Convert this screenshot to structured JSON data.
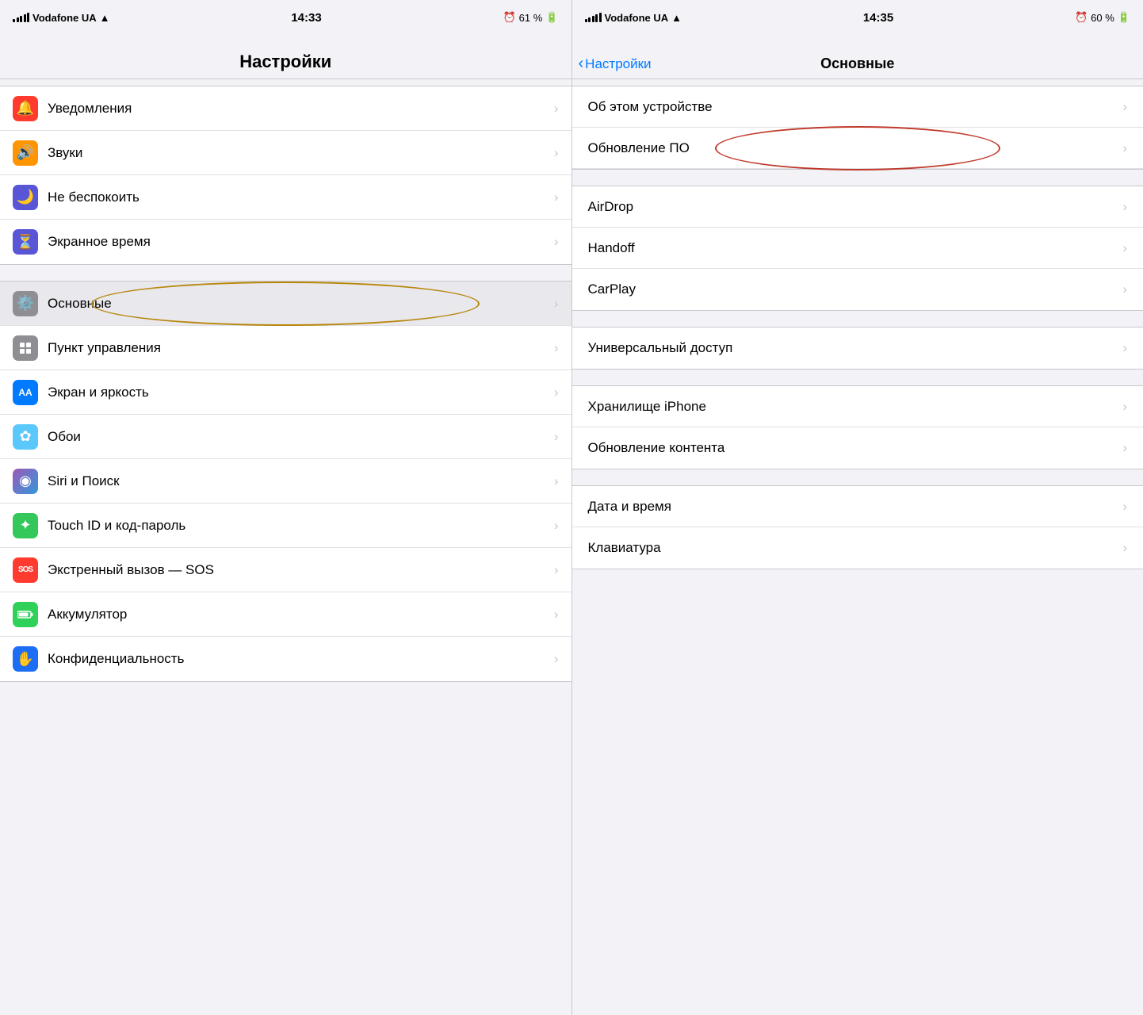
{
  "left_panel": {
    "status": {
      "carrier": "Vodafone UA",
      "time": "14:33",
      "battery": "61 %"
    },
    "title": "Настройки",
    "rows": [
      {
        "id": "notifications",
        "label": "Уведомления",
        "icon": "🔔",
        "icon_class": "icon-red"
      },
      {
        "id": "sounds",
        "label": "Звуки",
        "icon": "🔊",
        "icon_class": "icon-orange-light"
      },
      {
        "id": "do-not-disturb",
        "label": "Не беспокоить",
        "icon": "🌙",
        "icon_class": "icon-purple"
      },
      {
        "id": "screen-time",
        "label": "Экранное время",
        "icon": "⏳",
        "icon_class": "icon-blue"
      }
    ],
    "rows2": [
      {
        "id": "general",
        "label": "Основные",
        "icon": "⚙️",
        "icon_class": "icon-gray",
        "highlighted": true
      },
      {
        "id": "control-center",
        "label": "Пункт управления",
        "icon": "⊞",
        "icon_class": "icon-gray"
      },
      {
        "id": "display",
        "label": "Экран и яркость",
        "icon": "AA",
        "icon_class": "icon-blue"
      },
      {
        "id": "wallpaper",
        "label": "Обои",
        "icon": "✿",
        "icon_class": "icon-teal"
      },
      {
        "id": "siri",
        "label": "Siri и Поиск",
        "icon": "◉",
        "icon_class": "icon-indigo"
      },
      {
        "id": "touchid",
        "label": "Touch ID и код-пароль",
        "icon": "✦",
        "icon_class": "icon-green"
      },
      {
        "id": "sos",
        "label": "Экстренный вызов — SOS",
        "icon": "SOS",
        "icon_class": "icon-sos"
      },
      {
        "id": "battery",
        "label": "Аккумулятор",
        "icon": "▬",
        "icon_class": "icon-green2"
      },
      {
        "id": "privacy",
        "label": "Конфиденциальность",
        "icon": "✋",
        "icon_class": "icon-blue2"
      }
    ]
  },
  "right_panel": {
    "status": {
      "carrier": "Vodafone UA",
      "time": "14:35",
      "battery": "60 %"
    },
    "back_label": "Настройки",
    "title": "Основные",
    "groups": [
      {
        "rows": [
          {
            "id": "about",
            "label": "Об этом устройстве"
          },
          {
            "id": "software-update",
            "label": "Обновление ПО",
            "highlight": true
          }
        ]
      },
      {
        "rows": [
          {
            "id": "airdrop",
            "label": "AirDrop"
          },
          {
            "id": "handoff",
            "label": "Handoff"
          },
          {
            "id": "carplay",
            "label": "CarPlay"
          }
        ]
      },
      {
        "rows": [
          {
            "id": "accessibility",
            "label": "Универсальный доступ"
          }
        ]
      },
      {
        "rows": [
          {
            "id": "iphone-storage",
            "label": "Хранилище iPhone"
          },
          {
            "id": "background-app-refresh",
            "label": "Обновление контента"
          }
        ]
      },
      {
        "rows": [
          {
            "id": "date-time",
            "label": "Дата и время"
          },
          {
            "id": "keyboard",
            "label": "Клавиатура"
          }
        ]
      }
    ]
  }
}
